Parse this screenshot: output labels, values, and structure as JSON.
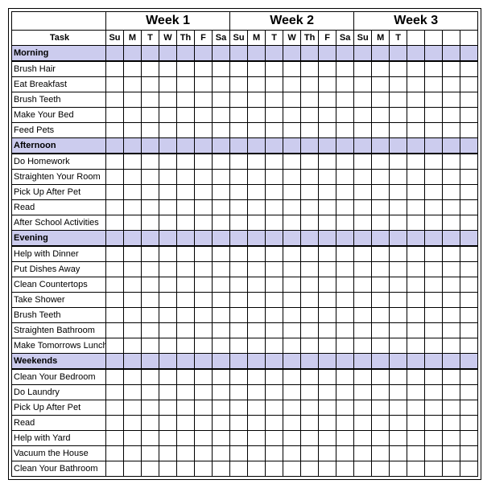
{
  "weeks": [
    "Week 1",
    "Week 2",
    "Week 3"
  ],
  "days": [
    "Su",
    "M",
    "T",
    "W",
    "Th",
    "F",
    "Sa",
    "Su",
    "M",
    "T",
    "W",
    "Th",
    "F",
    "Sa",
    "Su",
    "M",
    "T"
  ],
  "task_header": "Task",
  "sections": [
    {
      "name": "Morning",
      "tasks": [
        "Brush Hair",
        "Eat Breakfast",
        "Brush Teeth",
        "Make Your Bed",
        "Feed Pets"
      ]
    },
    {
      "name": "Afternoon",
      "tasks": [
        "Do Homework",
        "Straighten Your Room",
        "Pick Up After Pet",
        "Read",
        "After School Activities"
      ]
    },
    {
      "name": "Evening",
      "tasks": [
        "Help with Dinner",
        "Put Dishes Away",
        "Clean Countertops",
        "Take Shower",
        "Brush Teeth",
        "Straighten Bathroom",
        "Make Tomorrows Lunch"
      ]
    },
    {
      "name": "Weekends",
      "tasks": [
        "Clean Your Bedroom",
        "Do Laundry",
        "Pick Up After Pet",
        "Read",
        "Help with Yard",
        "Vacuum the House",
        "Clean Your Bathroom"
      ]
    }
  ]
}
